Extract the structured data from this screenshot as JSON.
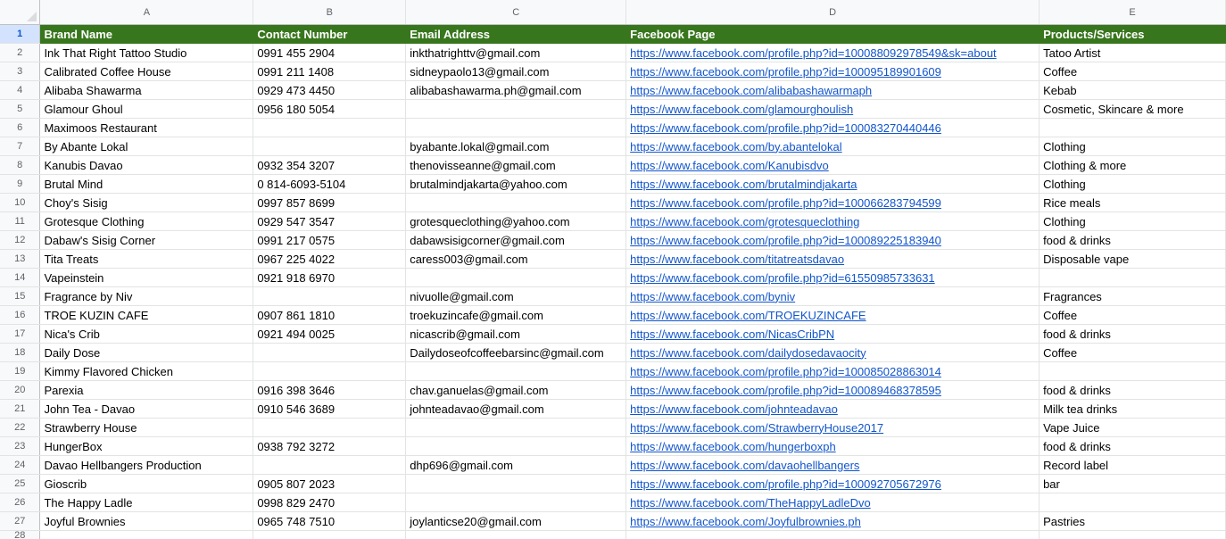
{
  "columns": [
    "A",
    "B",
    "C",
    "D",
    "E"
  ],
  "headers": [
    "Brand Name",
    "Contact Number",
    "Email Address",
    "Facebook Page",
    "Products/Services"
  ],
  "row_numbers": [
    "1",
    "2",
    "3",
    "4",
    "5",
    "6",
    "7",
    "8",
    "9",
    "10",
    "11",
    "12",
    "13",
    "14",
    "15",
    "16",
    "17",
    "18",
    "19",
    "20",
    "21",
    "22",
    "23",
    "24",
    "25",
    "26",
    "27",
    "28"
  ],
  "rows": [
    [
      "Ink That Right Tattoo Studio",
      "0991 455 2904",
      "inkthatrighttv@gmail.com",
      "https://www.facebook.com/profile.php?id=100088092978549&sk=about",
      "Tatoo Artist"
    ],
    [
      "Calibrated Coffee House",
      "0991 211 1408",
      "sidneypaolo13@gmail.com",
      "https://www.facebook.com/profile.php?id=100095189901609",
      "Coffee"
    ],
    [
      "Alibaba Shawarma",
      "0929 473 4450",
      "alibabashawarma.ph@gmail.com",
      "https://www.facebook.com/alibabashawarmaph",
      "Kebab"
    ],
    [
      "Glamour Ghoul",
      "0956 180 5054",
      "",
      "https://www.facebook.com/glamourghoulish",
      "Cosmetic, Skincare & more"
    ],
    [
      "Maximoos Restaurant",
      "",
      "",
      "https://www.facebook.com/profile.php?id=100083270440446",
      ""
    ],
    [
      "By Abante Lokal",
      "",
      "byabante.lokal@gmail.com",
      "https://www.facebook.com/by.abantelokal",
      "Clothing"
    ],
    [
      "Kanubis Davao",
      "0932 354 3207",
      "thenovisseanne@gmail.com",
      "https://www.facebook.com/Kanubisdvo",
      "Clothing & more"
    ],
    [
      "Brutal Mind",
      "0 814-6093-5104",
      "brutalmindjakarta@yahoo.com",
      "https://www.facebook.com/brutalmindjakarta",
      "Clothing"
    ],
    [
      "Choy's Sisig",
      "0997 857 8699",
      "",
      "https://www.facebook.com/profile.php?id=100066283794599",
      "Rice meals"
    ],
    [
      "Grotesque Clothing",
      "0929 547 3547",
      "grotesqueclothing@yahoo.com",
      "https://www.facebook.com/grotesqueclothing",
      "Clothing"
    ],
    [
      "Dabaw's Sisig Corner",
      "0991 217 0575",
      "dabawsisigcorner@gmail.com",
      "https://www.facebook.com/profile.php?id=100089225183940",
      "food & drinks"
    ],
    [
      "Tita Treats",
      "0967 225 4022",
      "caress003@gmail.com",
      "https://www.facebook.com/titatreatsdavao",
      "Disposable vape"
    ],
    [
      "Vapeinstein",
      "0921 918 6970",
      "",
      "https://www.facebook.com/profile.php?id=61550985733631",
      ""
    ],
    [
      "Fragrance by Niv",
      "",
      "nivuolle@gmail.com",
      "https://www.facebook.com/byniv",
      "Fragrances"
    ],
    [
      "TROE KUZIN CAFE",
      "0907 861 1810",
      "troekuzincafe@gmail.com",
      "https://www.facebook.com/TROEKUZINCAFE",
      "Coffee"
    ],
    [
      "Nica's Crib",
      "0921 494 0025",
      "nicascrib@gmail.com",
      "https://www.facebook.com/NicasCribPN",
      "food & drinks"
    ],
    [
      "Daily Dose",
      "",
      "Dailydoseofcoffeebarsinc@gmail.com",
      "https://www.facebook.com/dailydosedavaocity",
      "Coffee"
    ],
    [
      "Kimmy Flavored Chicken",
      "",
      "",
      "https://www.facebook.com/profile.php?id=100085028863014",
      ""
    ],
    [
      "Parexia",
      "0916 398 3646",
      "chav.ganuelas@gmail.com",
      "https://www.facebook.com/profile.php?id=100089468378595",
      "food & drinks"
    ],
    [
      "John Tea - Davao",
      "0910 546 3689",
      "johnteadavao@gmail.com",
      "https://www.facebook.com/johnteadavao",
      "Milk tea drinks"
    ],
    [
      "Strawberry House",
      "",
      "",
      "https://www.facebook.com/StrawberryHouse2017",
      "Vape Juice"
    ],
    [
      "HungerBox",
      "0938 792 3272",
      "",
      "https://www.facebook.com/hungerboxph",
      "food & drinks"
    ],
    [
      "Davao Hellbangers Production",
      "",
      "dhp696@gmail.com",
      "https://www.facebook.com/davaohellbangers",
      "Record label"
    ],
    [
      "Gioscrib",
      "0905 807 2023",
      "",
      "https://www.facebook.com/profile.php?id=100092705672976",
      "bar"
    ],
    [
      "The Happy Ladle",
      "0998 829 2470",
      "",
      "https://www.facebook.com/TheHappyLadleDvo",
      ""
    ],
    [
      "Joyful Brownies",
      "0965 748 7510",
      "joylanticse20@gmail.com",
      "https://www.facebook.com/Joyfulbrownies.ph",
      "Pastries"
    ]
  ],
  "colors": {
    "header_fill": "#38761d",
    "header_text": "#ffffff",
    "link": "#1155cc",
    "selected_row_header": "#d3e3fd"
  }
}
